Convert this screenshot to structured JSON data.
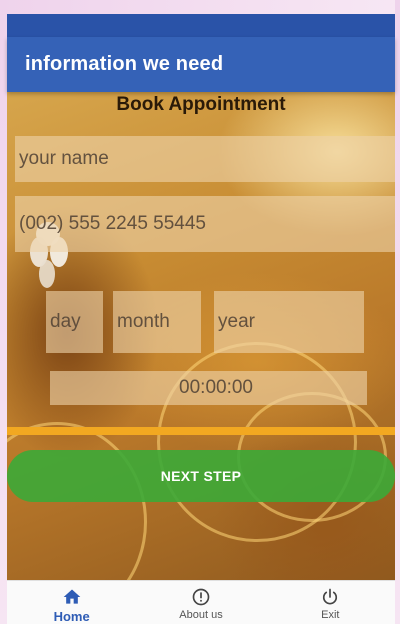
{
  "app_bar": {
    "title": "information we need"
  },
  "form": {
    "title": "Book Appointment",
    "name_placeholder": "your name",
    "phone_placeholder": "(002) 555 2245 55445",
    "day_placeholder": "day",
    "month_placeholder": "month",
    "year_placeholder": "year",
    "time_value": "00:00:00",
    "next_label": "NEXT STEP"
  },
  "bottom_nav": {
    "items": [
      {
        "label": "Home",
        "icon": "home-icon",
        "active": true
      },
      {
        "label": "About us",
        "icon": "info-icon",
        "active": false
      },
      {
        "label": "Exit",
        "icon": "power-icon",
        "active": false
      }
    ]
  },
  "colors": {
    "app_bar": "#3562b7",
    "status_bar": "#2a53a8",
    "accent_line": "#f2a821",
    "next_button": "#3caa37",
    "nav_active": "#2e5cb5"
  }
}
